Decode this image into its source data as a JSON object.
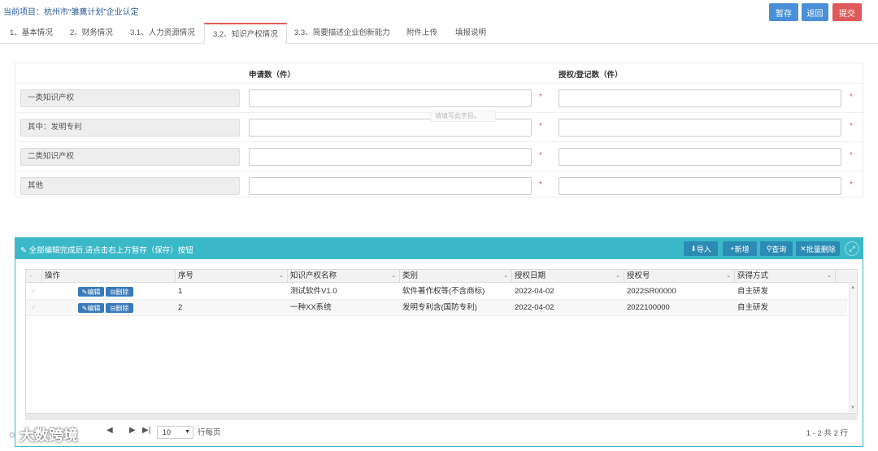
{
  "header": {
    "project_label": "当前项目：杭州市“雏鹰计划”企业认定",
    "save_label": "暂存",
    "back_label": "返回",
    "submit_label": "提交"
  },
  "tabs": [
    {
      "label": "1、基本情况"
    },
    {
      "label": "2、财务情况"
    },
    {
      "label": "3.1、人力资源情况"
    },
    {
      "label": "3.2、知识产权情况"
    },
    {
      "label": "3.3、简要描述企业创新能力"
    },
    {
      "label": "附件上传"
    },
    {
      "label": "填报说明"
    }
  ],
  "form": {
    "col_applied": "申请数（件）",
    "col_granted": "授权/登记数（件）",
    "required_mark": "*",
    "rows": [
      {
        "label": "一类知识产权",
        "applied": "",
        "granted": ""
      },
      {
        "label": "其中：发明专利",
        "applied": "",
        "granted": ""
      },
      {
        "label": "二类知识产权",
        "applied": "",
        "granted": ""
      },
      {
        "label": "其他",
        "applied": "",
        "granted": ""
      }
    ],
    "tooltip": "请填写此字段。"
  },
  "panel": {
    "title": "全部编辑完成后,请点击右上方暂存（保存）按钮",
    "import_label": "导入",
    "add_label": "新增",
    "query_label": "查询",
    "batch_delete_label": "批量删除"
  },
  "grid": {
    "columns": [
      "操作",
      "序号",
      "知识产权名称",
      "类别",
      "授权日期",
      "授权号",
      "获得方式"
    ],
    "edit_label": "编辑",
    "delete_label": "删除",
    "rows": [
      {
        "seq": "1",
        "name": "测试软件V1.0",
        "category": "软件著作权等(不含商标)",
        "date": "2022-04-02",
        "number": "2022SR00000",
        "method": "自主研发"
      },
      {
        "seq": "2",
        "name": "一种XX系统",
        "category": "发明专利含(国防专利)",
        "date": "2022-04-02",
        "number": "2022100000",
        "method": "自主研发"
      }
    ]
  },
  "pager": {
    "page_size": "10",
    "per_page_label": "行每页",
    "info": "1 - 2 共 2 行"
  },
  "watermark": "大数跨境",
  "colors": {
    "primary": "#4a90d9",
    "danger": "#e05a5a",
    "panel": "#3bb8c8"
  }
}
